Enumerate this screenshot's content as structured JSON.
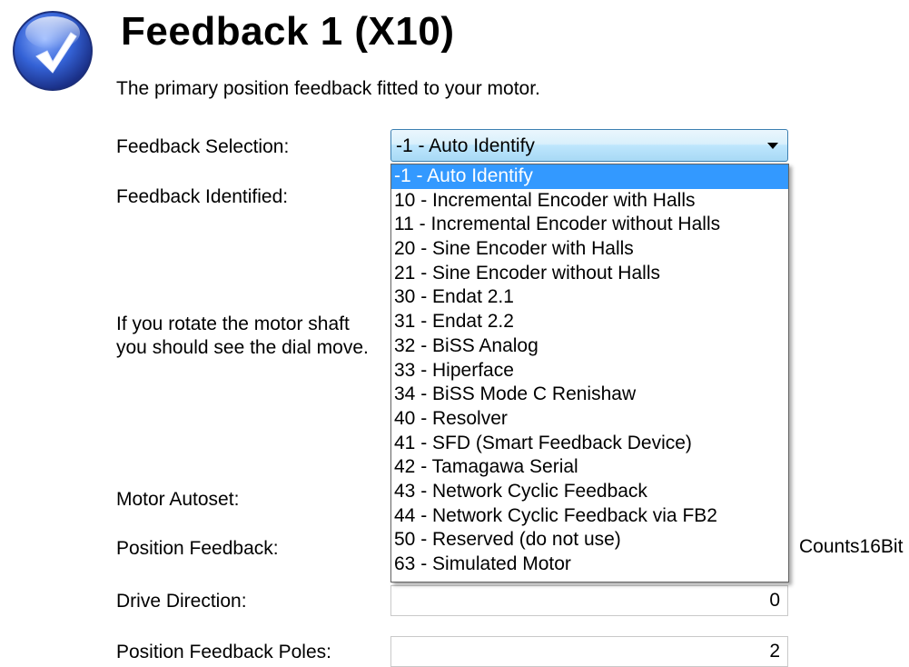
{
  "header": {
    "title": "Feedback 1 (X10)",
    "subtitle": "The primary position feedback fitted to your motor."
  },
  "labels": {
    "feedback_selection": "Feedback Selection:",
    "feedback_identified": "Feedback Identified:",
    "rotate_hint": "If you rotate the motor shaft you should see the dial move.",
    "motor_autoset": "Motor Autoset:",
    "position_feedback": "Position Feedback:",
    "drive_direction": "Drive Direction:",
    "position_feedback_poles": "Position Feedback Poles:"
  },
  "feedback_select": {
    "selected": "-1 - Auto Identify",
    "options": [
      "-1 - Auto Identify",
      "10 - Incremental Encoder with Halls",
      "11 - Incremental Encoder without Halls",
      "20 - Sine Encoder with Halls",
      "21 - Sine Encoder without Halls",
      "30 - Endat 2.1",
      "31 - Endat 2.2",
      "32 - BiSS Analog",
      "33 - Hiperface",
      "34 - BiSS Mode C Renishaw",
      "40 - Resolver",
      "41 - SFD (Smart Feedback Device)",
      "42 - Tamagawa Serial",
      "43 - Network Cyclic Feedback",
      "44 - Network Cyclic Feedback via FB2",
      "50 - Reserved (do not use)",
      "63 - Simulated Motor"
    ]
  },
  "fields": {
    "position_feedback_units": "Counts16Bit",
    "drive_direction_value": "0",
    "position_feedback_poles_value": "2"
  },
  "icons": {
    "logo": "checkmark-globe-icon",
    "dropdown_arrow": "chevron-down-icon"
  },
  "colors": {
    "selection": "#3399ff",
    "combo_border": "#3c7fb1",
    "logo_blue": "#2a55c8"
  }
}
